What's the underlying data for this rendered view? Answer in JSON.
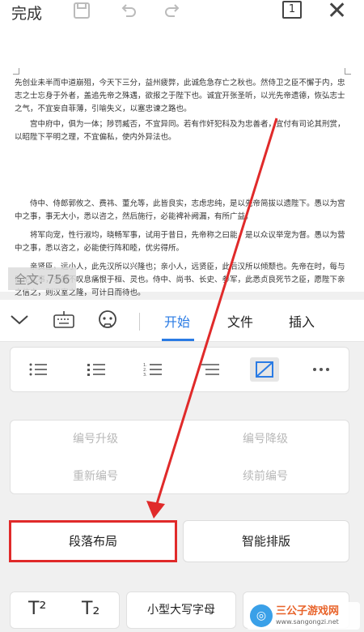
{
  "topbar": {
    "done_label": "完成",
    "page_number": "1"
  },
  "document": {
    "paragraphs": [
      "先创业未半而中道崩殂，今天下三分，益州疲弊，此诚危急存亡之秋也。然侍卫之臣不懈于内，忠志之士忘身于外者，盖追先帝之殊遇，欲报之于陛下也。诚宜开张圣听，以光先帝遗德，恢弘志士之气，不宜妄自菲薄，引喻失义，以塞忠谏之路也。",
      "宫中府中，俱为一体；陟罚臧否，不宜异同。若有作奸犯科及为忠善者，宜付有司论其刑赏，以昭陛下平明之理，不宜偏私，使内外异法也。",
      "侍中、侍郎郭攸之、费祎、董允等，此皆良实，志虑忠纯，是以先帝简拔以遗陛下。愚以为宫中之事，事无大小，悉以咨之，然后施行，必能裨补阙漏，有所广益。",
      "将军向宠，性行淑均，晓畅军事，试用于昔日，先帝称之曰能，是以众议举宠为督。愚以为营中之事，悉以咨之，必能使行阵和睦，优劣得所。",
      "亲贤臣，远小人，此先汉所以兴隆也；亲小人，远贤臣，此后汉所以倾颓也。先帝在时，每与臣论此事，未尝不叹息痛恨于桓、灵也。侍中、尚书、长史、参军，此悉贞良死节之臣，愿陛下亲之信之，则汉室之隆，可计日而待也。"
    ],
    "word_count": "全文: 756"
  },
  "toolbar": {
    "tabs": [
      "开始",
      "文件",
      "插入"
    ],
    "active_tab": "开始"
  },
  "list_tools": {
    "icons": [
      "bullet-list-icon",
      "bullet-list-dense-icon",
      "numbered-list-icon",
      "multilevel-list-icon",
      "no-style-icon",
      "more-icon"
    ]
  },
  "numbering": {
    "promote": "编号升级",
    "demote": "编号降级",
    "renumber": "重新编号",
    "continue": "续前编号"
  },
  "layout_buttons": {
    "paragraph_layout": "段落布局",
    "smart_layout": "智能排版"
  },
  "bottom_row": {
    "superscript": "T²",
    "subscript": "T₂",
    "small_caps": "小型大写字母"
  },
  "watermark": {
    "name": "三公子游戏网",
    "url": "www.sangongzi.net"
  },
  "colors": {
    "accent": "#2a7be4",
    "highlight": "#e02a2a"
  }
}
